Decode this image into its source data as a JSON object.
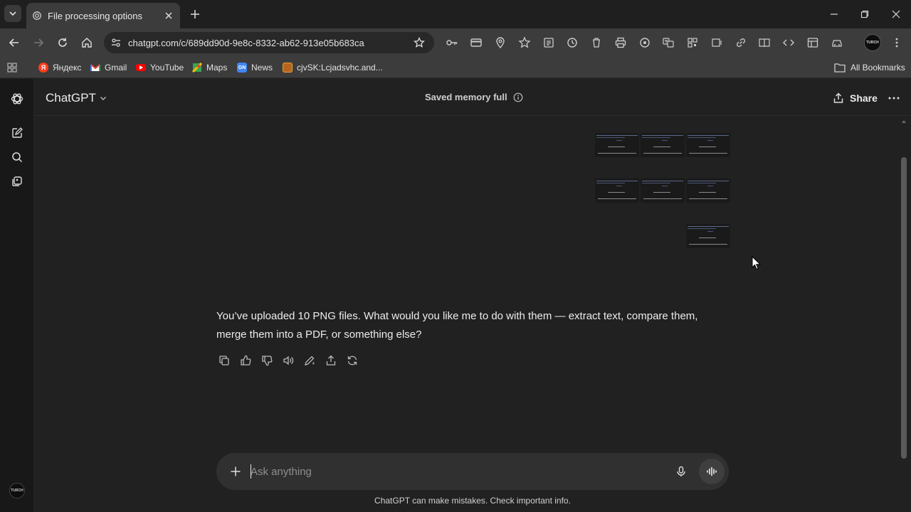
{
  "browser": {
    "tab_title": "File processing options",
    "url": "chatgpt.com/c/689dd90d-9e8c-8332-ab62-913e05b683ca",
    "bookmarks": [
      {
        "label": "Яндекс",
        "icon": "yandex-icon",
        "color": "#fc3f1d"
      },
      {
        "label": "Gmail",
        "icon": "gmail-icon",
        "color": "#ea4335"
      },
      {
        "label": "YouTube",
        "icon": "youtube-icon",
        "color": "#ff0000"
      },
      {
        "label": "Maps",
        "icon": "maps-icon",
        "color": "#34a853"
      },
      {
        "label": "News",
        "icon": "news-icon",
        "color": "#4285f4"
      },
      {
        "label": "cjvSK:Lcjadsvhc.and...",
        "icon": "bookmark-favicon-icon",
        "color": "#e8a23a"
      }
    ],
    "all_bookmarks_label": "All Bookmarks",
    "profile_avatar_text": "TURCH"
  },
  "header": {
    "model_name": "ChatGPT",
    "memory_status": "Saved memory full",
    "share_label": "Share"
  },
  "rail": {
    "avatar_text": "TURCH"
  },
  "conversation": {
    "uploaded_image_count": 10,
    "assistant_message": "You’ve uploaded 10 PNG files. What would you like me to do with them — extract text, compare them, merge them into a PDF, or something else?"
  },
  "composer": {
    "placeholder": "Ask anything",
    "value": ""
  },
  "footer": {
    "disclaimer": "ChatGPT can make mistakes. Check important info."
  },
  "colors": {
    "page_bg": "#212121",
    "rail_bg": "#181818",
    "composer_bg": "#303030",
    "chrome_bg": "#3c3c3c"
  }
}
